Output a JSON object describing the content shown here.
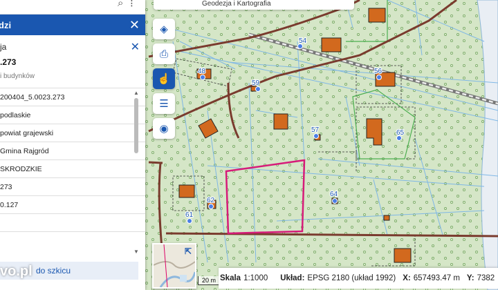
{
  "colors": {
    "map_background": "#d5e6c7",
    "parcel_line": "#7fb7e6",
    "building": "#d2691e",
    "road": "#7a3b2e",
    "selected_parcel": "#d61b79",
    "accent": "#1a57b0"
  },
  "top": {
    "search_icon": "search-icon",
    "location_icon": "location-icon"
  },
  "panel": {
    "title": "dzi",
    "close_icon": "close-icon",
    "section": "ja",
    "parcel_id": ".273",
    "muted": "i budynków",
    "rows": [
      "200404_5.0023.273",
      "podlaskie",
      "powiat grajewski",
      "Gmina Rajgród",
      "SKRODZKIE",
      "273",
      "0.127"
    ],
    "bottom_button": "do szkicu"
  },
  "watermark": "vo.pl",
  "map_topbar": "Geodezja i Kartografia",
  "toolbar": [
    {
      "icon": "layers-icon",
      "glyph": "◈"
    },
    {
      "icon": "print-icon",
      "glyph": "⎙"
    },
    {
      "icon": "hand-pointer-icon",
      "glyph": "☝"
    },
    {
      "icon": "clipboard-icon",
      "glyph": "☰"
    },
    {
      "icon": "camera-icon",
      "glyph": "◉"
    }
  ],
  "map_labels": [
    "54",
    "48",
    "59",
    "56",
    "57",
    "65",
    "62",
    "64",
    "61"
  ],
  "minimap": {
    "expand_icon": "external-link-icon"
  },
  "scale_bar": "20 m",
  "status": {
    "scale_label": "Skala",
    "scale_value": "1:1000",
    "system_label": "Układ:",
    "system_value": "EPSG 2180 (układ 1992)",
    "x_label": "X:",
    "x_value": "657493.47 m",
    "y_label": "Y:",
    "y_value": "7382"
  }
}
